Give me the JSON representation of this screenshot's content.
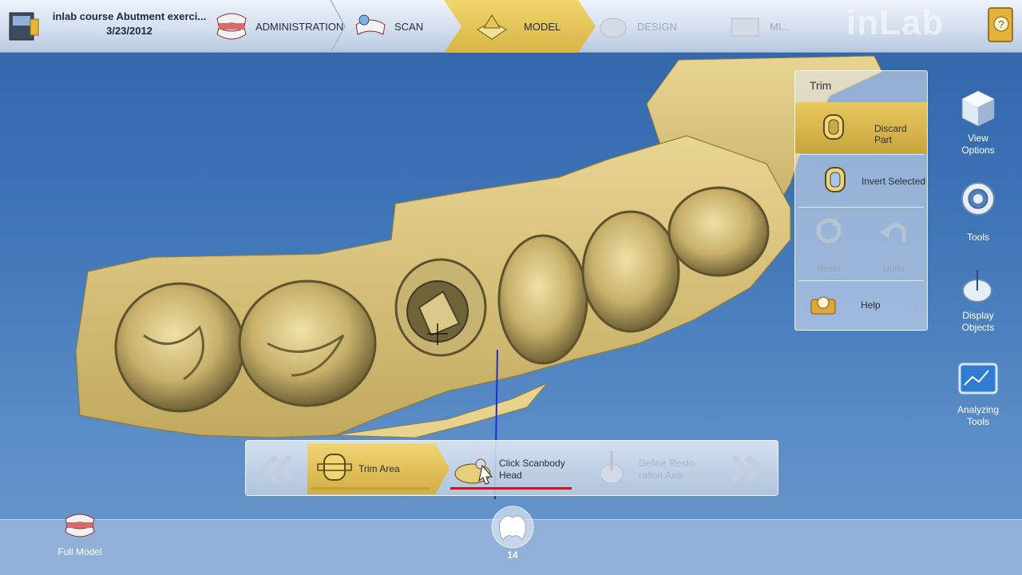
{
  "header": {
    "doc_title": "inlab course Abutment exerci...",
    "doc_date": "3/23/2012",
    "steps": [
      {
        "label": "ADMINISTRATION",
        "state": "done"
      },
      {
        "label": "SCAN",
        "state": "done"
      },
      {
        "label": "MODEL",
        "state": "active"
      },
      {
        "label": "DESIGN",
        "state": "disabled"
      },
      {
        "label": "MI...",
        "state": "disabled"
      }
    ],
    "brand": "inLab"
  },
  "trim_panel": {
    "title": "Trim",
    "discard_label": "Discard Part",
    "invert_label": "Invert Selected",
    "reset_label": "Reset",
    "undo_label": "Undo",
    "help_label": "Help"
  },
  "right_toolbar": {
    "view_options": "View Options",
    "tools": "Tools",
    "display_objects": "Display Objects",
    "analyzing_tools": "Analyzing Tools"
  },
  "step_bar": {
    "trim_area": "Trim Area",
    "click_scanbody_line1": "Click Scanbody",
    "click_scanbody_line2": "Head",
    "define_axis_line1": "Define Resto-",
    "define_axis_line2": "ration Axis"
  },
  "bottom": {
    "full_model": "Full Model",
    "tooth_number": "14"
  },
  "colors": {
    "model_gold": "#d8c27a",
    "accent_gold": "#e2c25a",
    "axis_blue": "#1d2fd6",
    "highlight_red": "#d0141c"
  }
}
